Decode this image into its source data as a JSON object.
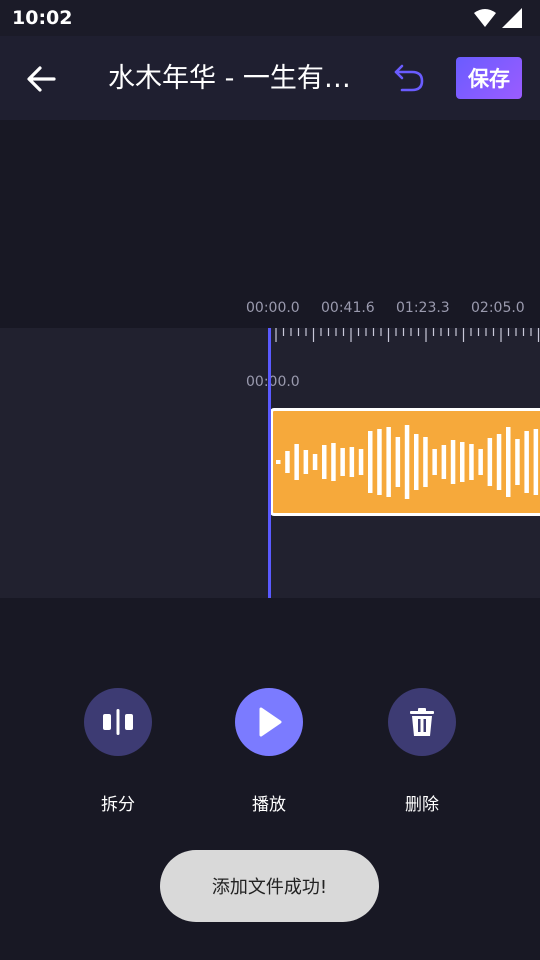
{
  "status_bar": {
    "time": "10:02"
  },
  "header": {
    "title": "水木年华 - 一生有…",
    "save_label": "保存"
  },
  "ruler": {
    "labels": [
      "00:00.0",
      "00:41.6",
      "01:23.3",
      "02:05.0"
    ]
  },
  "timeline": {
    "clip_start": "00:00.0"
  },
  "controls": {
    "split_label": "拆分",
    "play_label": "播放",
    "delete_label": "删除"
  },
  "toast": {
    "message": "添加文件成功!"
  },
  "colors": {
    "accent": "#7b7bff",
    "clip": "#f6a93b",
    "playhead": "#5a5aff"
  }
}
